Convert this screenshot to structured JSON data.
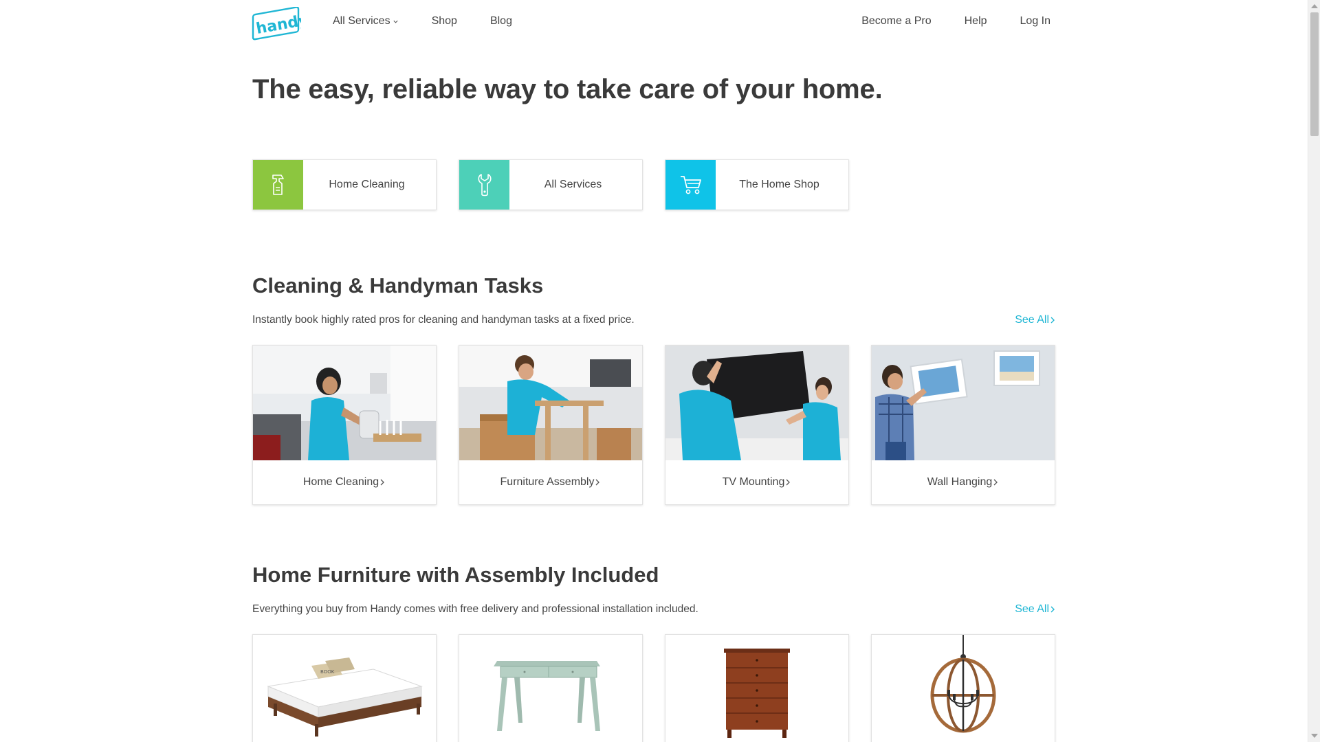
{
  "brand": {
    "name": "handy",
    "color": "#1eb6d4"
  },
  "nav": {
    "left": [
      {
        "label": "All Services",
        "has_dropdown": true
      },
      {
        "label": "Shop"
      },
      {
        "label": "Blog"
      }
    ],
    "right": [
      {
        "label": "Become a Pro"
      },
      {
        "label": "Help"
      },
      {
        "label": "Log In"
      }
    ]
  },
  "hero": {
    "title": "The easy, reliable way to take care of your home."
  },
  "quick_links": [
    {
      "label": "Home Cleaning",
      "icon": "spray-bottle-icon",
      "color": "#8cc63f"
    },
    {
      "label": "All Services",
      "icon": "wrench-icon",
      "color": "#4dd0b8"
    },
    {
      "label": "The Home Shop",
      "icon": "shopping-cart-icon",
      "color": "#0fc3e8"
    }
  ],
  "tasks_section": {
    "title": "Cleaning & Handyman Tasks",
    "description": "Instantly book highly rated pros for cleaning and handyman tasks at a fixed price.",
    "see_all": "See All",
    "cards": [
      {
        "label": "Home Cleaning"
      },
      {
        "label": "Furniture Assembly"
      },
      {
        "label": "TV Mounting"
      },
      {
        "label": "Wall Hanging"
      }
    ]
  },
  "furniture_section": {
    "title": "Home Furniture with Assembly Included",
    "description": "Everything you buy from Handy comes with free delivery and professional installation included.",
    "see_all": "See All",
    "products": [
      {
        "icon": "bed-image"
      },
      {
        "icon": "desk-image"
      },
      {
        "icon": "dresser-image"
      },
      {
        "icon": "chandelier-image"
      }
    ]
  }
}
